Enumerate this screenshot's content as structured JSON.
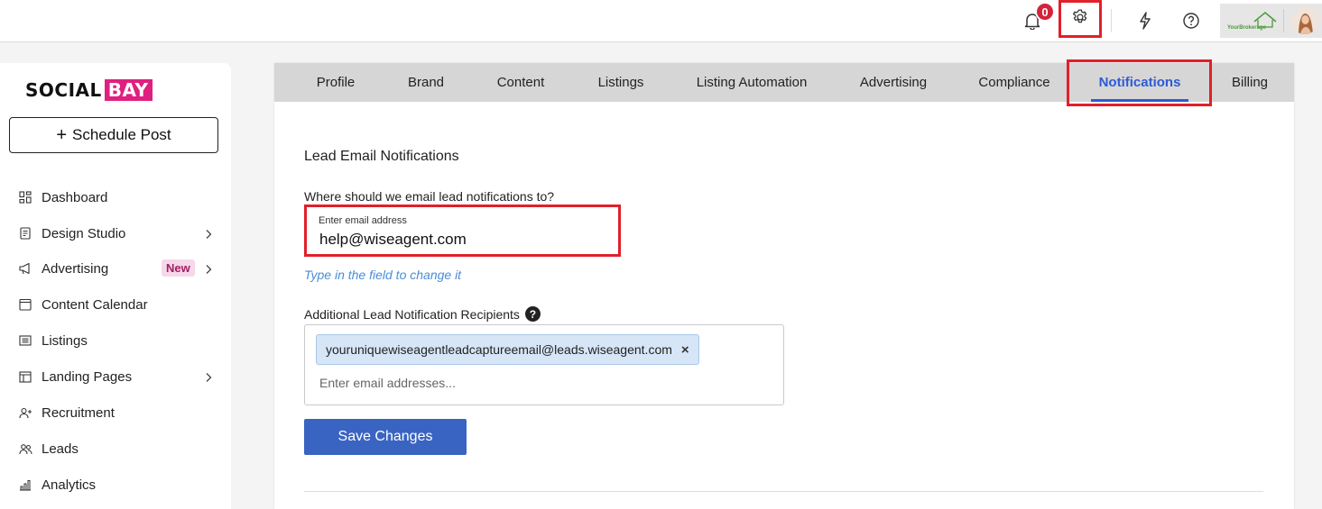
{
  "topbar": {
    "notification_count": "0",
    "brand_logo_text": "YourBrokerage"
  },
  "sidebar": {
    "logo_part1": "SOCIAL",
    "logo_part2": "BAY",
    "schedule_button": "Schedule Post",
    "items": [
      {
        "label": "Dashboard",
        "icon": "grid-icon"
      },
      {
        "label": "Design Studio",
        "icon": "document-icon"
      },
      {
        "label": "Advertising",
        "icon": "megaphone-icon",
        "badge": "New"
      },
      {
        "label": "Content Calendar",
        "icon": "calendar-icon"
      },
      {
        "label": "Listings",
        "icon": "list-icon"
      },
      {
        "label": "Landing Pages",
        "icon": "layout-icon"
      },
      {
        "label": "Recruitment",
        "icon": "add-user-icon"
      },
      {
        "label": "Leads",
        "icon": "users-icon"
      },
      {
        "label": "Analytics",
        "icon": "bar-chart-icon"
      }
    ]
  },
  "tabs": [
    {
      "label": "Profile"
    },
    {
      "label": "Brand"
    },
    {
      "label": "Content"
    },
    {
      "label": "Listings"
    },
    {
      "label": "Listing Automation"
    },
    {
      "label": "Advertising"
    },
    {
      "label": "Compliance"
    },
    {
      "label": "Notifications",
      "active": true
    },
    {
      "label": "Billing"
    }
  ],
  "form": {
    "section_title": "Lead Email Notifications",
    "email_question": "Where should we email lead notifications to?",
    "email_placeholder": "Enter email address",
    "email_value": "help@wiseagent.com",
    "email_hint": "Type in the field to change it",
    "additional_label": "Additional Lead Notification Recipients",
    "help_glyph": "?",
    "recipients": [
      "youruniquewiseagentleadcaptureemail@leads.wiseagent.com"
    ],
    "recipients_placeholder": "Enter email addresses...",
    "save_button": "Save Changes"
  },
  "colors": {
    "accent_blue": "#2e5ad6",
    "save_button": "#3a64c2",
    "highlight_red": "#e0202a",
    "brand_pink": "#e0207f",
    "new_badge_bg": "#f6d8ea",
    "badge_red": "#d3243a"
  }
}
